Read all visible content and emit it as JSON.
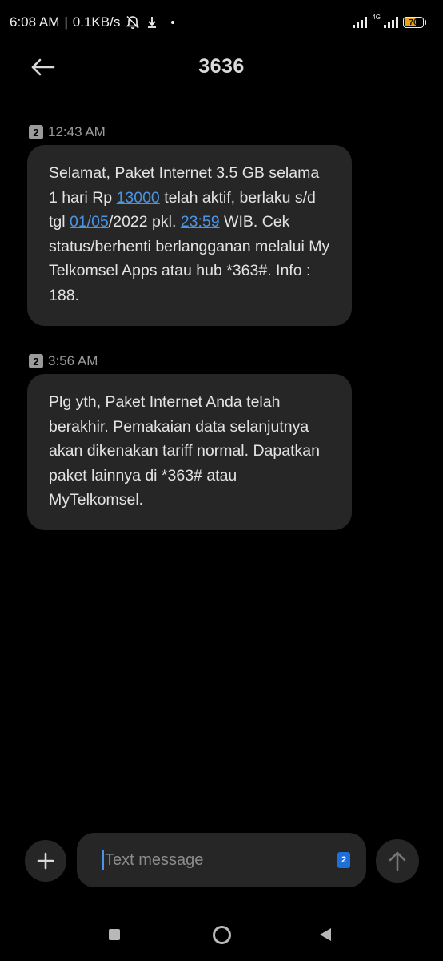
{
  "status_bar": {
    "time": "6:08 AM",
    "separator": "|",
    "speed": "0.1KB/s",
    "network_type": "4G",
    "battery_level": "70",
    "battery_color": "#e8a317",
    "icons": [
      "muted-bell-icon",
      "download-icon",
      "signal-icon",
      "signal-4g-icon",
      "battery-icon"
    ]
  },
  "header": {
    "title": "3636",
    "back_icon": "arrow-left-icon"
  },
  "messages": [
    {
      "sim": "2",
      "time": "12:43 AM",
      "segments": [
        {
          "text": "Selamat, Paket Internet 3.5 GB selama 1 hari Rp ",
          "link": false
        },
        {
          "text": "13000",
          "link": true
        },
        {
          "text": " telah aktif, berlaku s/d tgl ",
          "link": false
        },
        {
          "text": "01/05",
          "link": true
        },
        {
          "text": "/2022 pkl. ",
          "link": false
        },
        {
          "text": "23:59",
          "link": true
        },
        {
          "text": " WIB. Cek status/berhenti berlangganan melalui My Telkomsel Apps atau hub *363#. Info : 188.",
          "link": false
        }
      ]
    },
    {
      "sim": "2",
      "time": "3:56 AM",
      "segments": [
        {
          "text": "Plg yth, Paket Internet Anda telah berakhir. Pemakaian data selanjutnya akan dikenakan tariff normal. Dapatkan paket lainnya di *363# atau MyTelkomsel.",
          "link": false
        }
      ]
    }
  ],
  "composer": {
    "placeholder": "Text message",
    "sim": "2",
    "add_icon": "plus-icon",
    "send_icon": "arrow-up-icon"
  },
  "nav": {
    "recents_icon": "square-icon",
    "home_icon": "circle-icon",
    "back_icon": "triangle-back-icon"
  },
  "colors": {
    "background": "#000000",
    "bubble": "#262626",
    "link": "#4a94e6",
    "sim_pill": "#1e6fd9"
  }
}
